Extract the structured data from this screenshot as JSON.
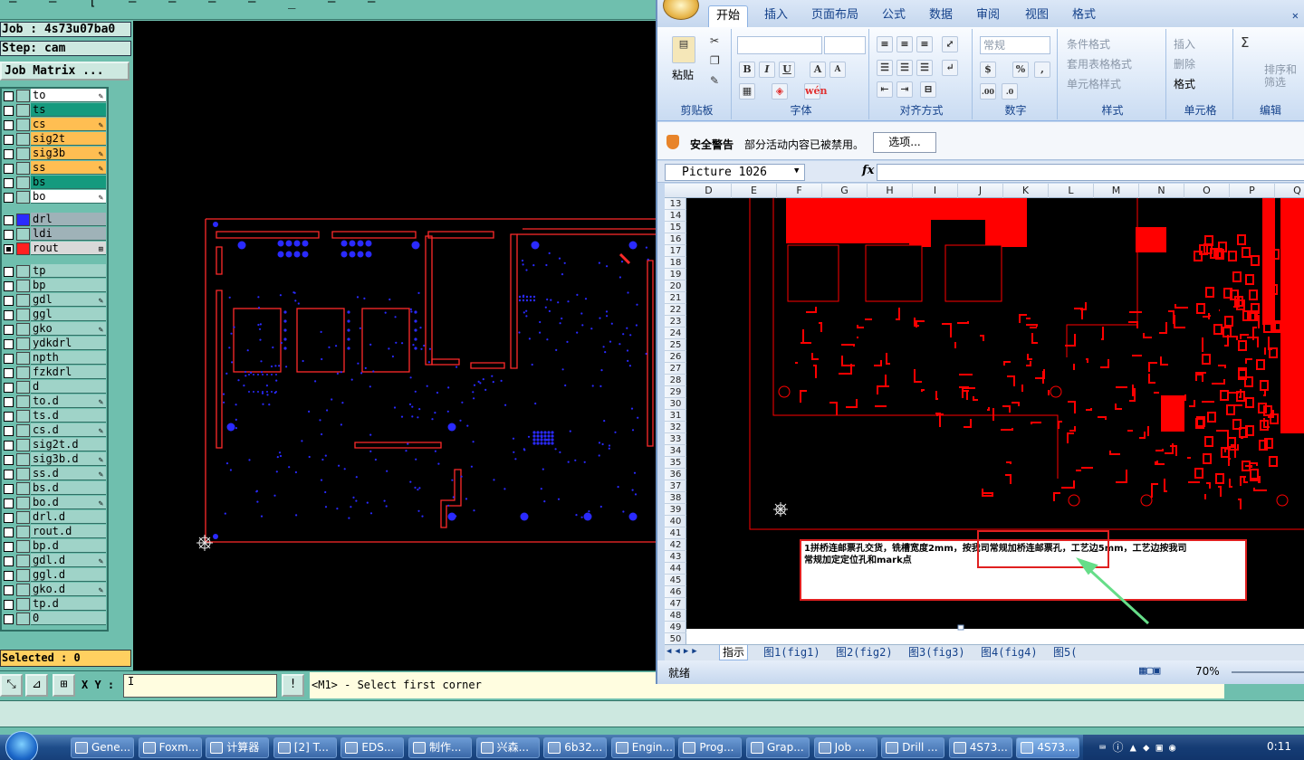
{
  "cam": {
    "top_fragments": [
      "–",
      "–",
      "[",
      "–",
      "–",
      "–",
      "–",
      "_",
      "–",
      "–"
    ],
    "job": "Job : 4s73u07ba0",
    "step": "Step: cam",
    "job_matrix": "Job Matrix ...",
    "layer_groups": [
      [
        {
          "name": "to",
          "color": "#ffffff",
          "mark": "✎"
        },
        {
          "name": "ts",
          "color": "#159a7e",
          "mark": ""
        },
        {
          "name": "cs",
          "color": "#ffbe52",
          "mark": "✎"
        },
        {
          "name": "sig2t",
          "color": "#ffbe52",
          "mark": ""
        },
        {
          "name": "sig3b",
          "color": "#ffbe52",
          "mark": "✎"
        },
        {
          "name": "ss",
          "color": "#ffbe52",
          "mark": "✎"
        },
        {
          "name": "bs",
          "color": "#159a7e",
          "mark": ""
        },
        {
          "name": "bo",
          "color": "#ffffff",
          "mark": "✎"
        }
      ],
      [
        {
          "name": "drl",
          "color": "#9fb2b8",
          "swatch": "#2a2aff",
          "mark": ""
        },
        {
          "name": "ldi",
          "color": "#9fb2b8",
          "mark": ""
        },
        {
          "name": "rout",
          "color": "#d9d9d9",
          "swatch": "#ff2020",
          "mark": "⊞",
          "checked": true
        }
      ],
      [
        {
          "name": "tp",
          "mark": ""
        },
        {
          "name": "bp",
          "mark": ""
        },
        {
          "name": "gdl",
          "mark": "✎"
        },
        {
          "name": "ggl",
          "mark": ""
        },
        {
          "name": "gko",
          "mark": "✎"
        },
        {
          "name": "ydkdrl",
          "mark": ""
        },
        {
          "name": "npth",
          "mark": ""
        },
        {
          "name": "fzkdrl",
          "mark": ""
        },
        {
          "name": "d",
          "mark": ""
        },
        {
          "name": "to.d",
          "mark": "✎"
        },
        {
          "name": "ts.d",
          "mark": ""
        },
        {
          "name": "cs.d",
          "mark": "✎"
        },
        {
          "name": "sig2t.d",
          "mark": ""
        },
        {
          "name": "sig3b.d",
          "mark": "✎"
        },
        {
          "name": "ss.d",
          "mark": "✎"
        },
        {
          "name": "bs.d",
          "mark": ""
        },
        {
          "name": "bo.d",
          "mark": "✎"
        },
        {
          "name": "drl.d",
          "mark": ""
        },
        {
          "name": "rout.d",
          "mark": ""
        },
        {
          "name": "bp.d",
          "mark": ""
        },
        {
          "name": "gdl.d",
          "mark": "✎"
        },
        {
          "name": "ggl.d",
          "mark": ""
        },
        {
          "name": "gko.d",
          "mark": "✎"
        },
        {
          "name": "tp.d",
          "mark": ""
        },
        {
          "name": "0",
          "mark": ""
        }
      ]
    ],
    "selected": "Selected : 0",
    "xy_label": "X Y :",
    "xy_value": "I",
    "prompt_icon": "!",
    "prompt": "<M1> - Select first corner",
    "colors": {
      "outline": "#ff2a2a",
      "pads": "#2a2aff"
    }
  },
  "excel": {
    "tabs": [
      "开始",
      "插入",
      "页面布局",
      "公式",
      "数据",
      "审阅",
      "视图",
      "格式"
    ],
    "active_tab": "开始",
    "groups": [
      {
        "label": "剪贴板",
        "items": [
          "粘贴"
        ]
      },
      {
        "label": "字体",
        "items": [
          "B",
          "I",
          "U",
          "A",
          "A",
          "wén"
        ]
      },
      {
        "label": "对齐方式",
        "items": []
      },
      {
        "label": "数字",
        "items": [
          "常规",
          "%",
          ",",
          ".00",
          ".0"
        ]
      },
      {
        "label": "样式",
        "items": [
          "条件格式",
          "套用表格格式",
          "单元格样式"
        ]
      },
      {
        "label": "单元格",
        "items": [
          "插入",
          "删除",
          "格式"
        ]
      },
      {
        "label": "编辑",
        "items": [
          "Σ",
          "排序和筛选"
        ]
      }
    ],
    "security": {
      "title": "安全警告",
      "message": "部分活动内容已被禁用。",
      "button": "选项..."
    },
    "name_box": "Picture 1026",
    "fx": "fx",
    "columns": [
      "D",
      "E",
      "F",
      "G",
      "H",
      "I",
      "J",
      "K",
      "L",
      "M",
      "N",
      "O",
      "P",
      "Q"
    ],
    "rows": [
      "13",
      "14",
      "15",
      "16",
      "17",
      "18",
      "19",
      "20",
      "21",
      "22",
      "23",
      "24",
      "25",
      "26",
      "27",
      "28",
      "29",
      "30",
      "31",
      "32",
      "33",
      "34",
      "35",
      "36",
      "37",
      "38",
      "39",
      "40",
      "41",
      "42",
      "43",
      "44",
      "45",
      "46",
      "47",
      "48",
      "49",
      "50"
    ],
    "note_line1": "1拼桥连邮票孔交货，铣槽宽度2mm，按我司常规加桥连邮票孔，工艺边5mm，工艺边按我司",
    "note_line2": "常规加定定位孔和mark点",
    "sheet_tabs": [
      "指示",
      "图1(fig1)",
      "图2(fig2)",
      "图3(fig3)",
      "图4(fig4)",
      "图5("
    ],
    "active_sheet": "指示",
    "status": "就绪",
    "zoom": "70%",
    "colors": {
      "pcb": "#ff0000",
      "annotation_arrow": "#66dd88",
      "highlight_box": "#e02020"
    }
  },
  "taskbar": {
    "items": [
      "Gene...",
      "Foxm...",
      "计算器",
      "[2] T...",
      "EDS...",
      "制作...",
      "兴森...",
      "6b32...",
      "Engin...",
      "Prog...",
      "Grap...",
      "Job ...",
      "Drill ...",
      "4S73...",
      "4S73..."
    ],
    "active_index": 14,
    "clock": "0:11"
  }
}
